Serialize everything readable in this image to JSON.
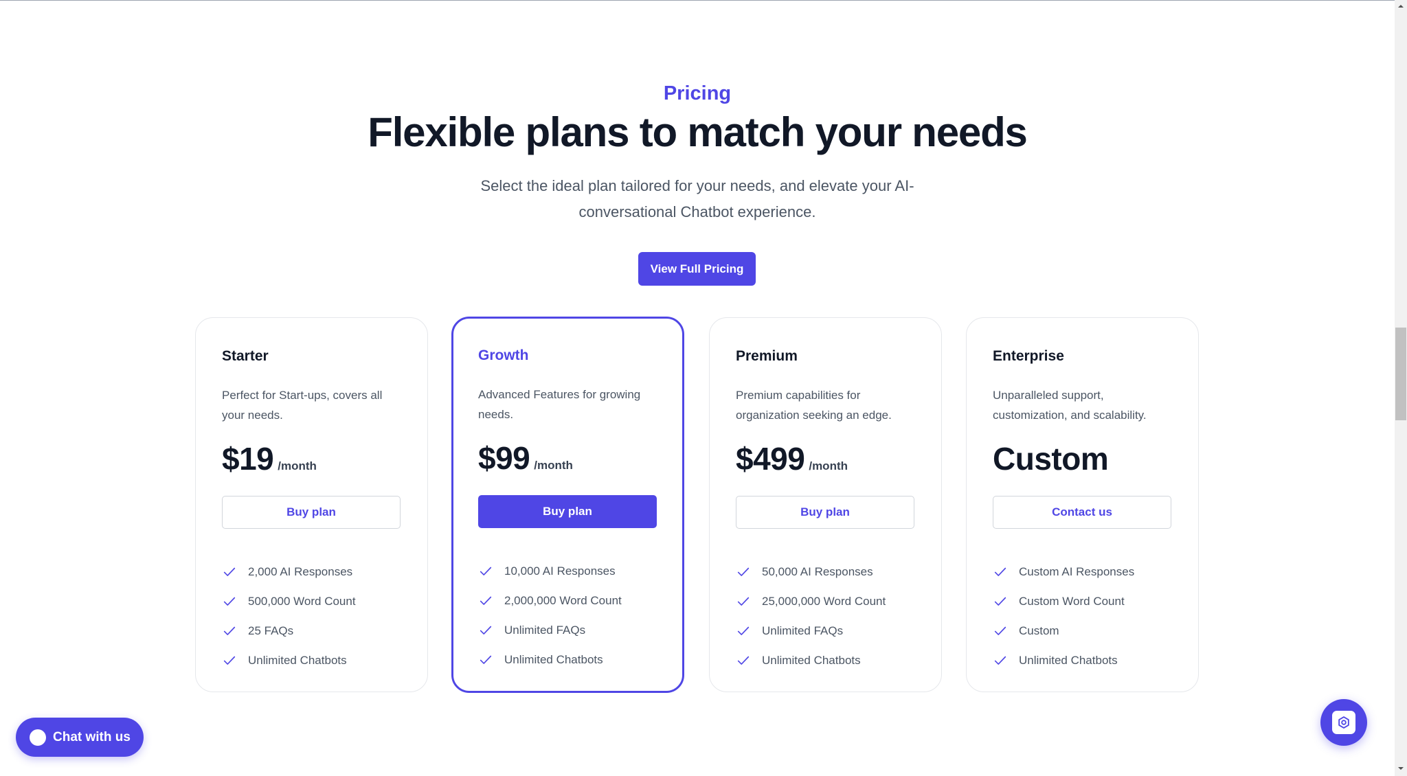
{
  "section": {
    "eyebrow": "Pricing",
    "title": "Flexible plans to match your needs",
    "subtitle": "Select the ideal plan tailored for your needs, and elevate your AI-conversational Chatbot experience.",
    "cta_label": "View Full Pricing"
  },
  "plans": [
    {
      "name": "Starter",
      "description": "Perfect for Start-ups, covers all your needs.",
      "price": "$19",
      "period": "/month",
      "button": "Buy plan",
      "features": [
        "2,000 AI Responses",
        "500,000 Word Count",
        "25 FAQs",
        "Unlimited Chatbots"
      ]
    },
    {
      "name": "Growth",
      "description": "Advanced Features for growing needs.",
      "price": "$99",
      "period": "/month",
      "button": "Buy plan",
      "features": [
        "10,000 AI Responses",
        "2,000,000 Word Count",
        "Unlimited FAQs",
        "Unlimited Chatbots"
      ]
    },
    {
      "name": "Premium",
      "description": "Premium capabilities for organization seeking an edge.",
      "price": "$499",
      "period": "/month",
      "button": "Buy plan",
      "features": [
        "50,000 AI Responses",
        "25,000,000 Word Count",
        "Unlimited FAQs",
        "Unlimited Chatbots"
      ]
    },
    {
      "name": "Enterprise",
      "description": "Unparalleled support, customization, and scalability.",
      "price": "Custom",
      "period": "",
      "button": "Contact us",
      "features": [
        "Custom AI Responses",
        "Custom Word Count",
        "Custom",
        "Unlimited Chatbots"
      ]
    }
  ],
  "chat_widget": {
    "label": "Chat with us",
    "icon": "chat-bubble-icon"
  },
  "floating_button": {
    "icon": "assistant-icon"
  },
  "icons": {
    "feature": "check-icon"
  },
  "colors": {
    "accent": "#4f46e5",
    "heading": "#111827",
    "body": "#4b5563",
    "border": "#e5e7eb"
  }
}
